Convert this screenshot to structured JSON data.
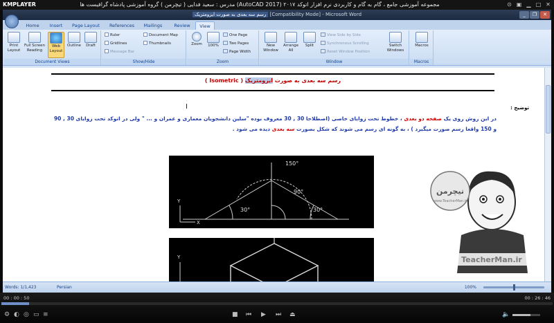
{
  "player": {
    "logo": "KMPLAYER",
    "title": "مجموعه آموزشی جامع ، گام به گام و کاربردی نرم افزار اتوکد ۲۰۱۷ (AutoCAD 2017) مدرس : سعید فدایی ( تیچرمن ) گروه آموزشی پادشاه گرافیست ها",
    "time_elapsed": "00 : 00 : 50",
    "time_total": "00 : 26 : 46",
    "progress": 0.05,
    "volume": 0.65
  },
  "word": {
    "title_prefix": "رسم سه بعدی به صورت ایزومتریک",
    "title_suffix": "[Compatibility Mode] - Microsoft Word",
    "tabs": [
      "Home",
      "Insert",
      "Page Layout",
      "References",
      "Mailings",
      "Review",
      "View"
    ],
    "active_tab": "View",
    "groups": {
      "document_views": {
        "label": "Document Views",
        "buttons": [
          "Print Layout",
          "Full Screen Reading",
          "Web Layout",
          "Outline",
          "Draft"
        ]
      },
      "show_hide": {
        "label": "Show/Hide",
        "items": [
          "Ruler",
          "Gridlines",
          "Message Bar",
          "Document Map",
          "Thumbnails"
        ]
      },
      "zoom": {
        "label": "Zoom",
        "buttons": [
          "Zoom",
          "100%"
        ],
        "items": [
          "One Page",
          "Two Pages",
          "Page Width"
        ]
      },
      "window": {
        "label": "Window",
        "buttons": [
          "New Window",
          "Arrange All",
          "Split"
        ],
        "items": [
          "View Side by Side",
          "Synchronous Scrolling",
          "Reset Window Position"
        ],
        "switch": "Switch Windows"
      },
      "macros": {
        "label": "Macros",
        "button": "Macros"
      }
    },
    "document": {
      "heading_pre": "رسم سه بعدی به صورت",
      "heading_hl": "ایزومتریک",
      "heading_en": "( Isometric )",
      "section_label": "توضیح :",
      "p1_a": "در این روش روی یک",
      "p1_red": "صفحه دو بعدی",
      "p1_b": "، خطوط تحت زوایای خاصی (اصطلاحا 30 , 30 معروف بوده \"سلین دانشجویان معماری و عمران و ... \" ولی در اتوکد تحت زوایای 30 , 90 و 150 واقعا رسم صورت میگیرد ) ، به گونه ای رسم می شوند که شکل بصورت",
      "p1_red2": "سه بعدی",
      "p1_c": "دیده می شود ."
    },
    "cad1": {
      "angles": [
        "150°",
        "90°",
        "30°",
        "30°"
      ],
      "axis_y": "Y",
      "axis_x": "X"
    },
    "cad2": {
      "axis_y": "Y"
    },
    "watermark": {
      "brand": "تیچرمن",
      "url": "www.TeacherMan.ir",
      "url_label": "TeacherMan.ir"
    },
    "status": {
      "words": "Words: 1/1,423",
      "language": "Persian",
      "zoom": "100%"
    }
  },
  "colors": {
    "title_bar": "#1b2a40",
    "ribbon": "#cadcf3",
    "heading_red": "#c00000",
    "body_blue": "#1f3aa8"
  }
}
